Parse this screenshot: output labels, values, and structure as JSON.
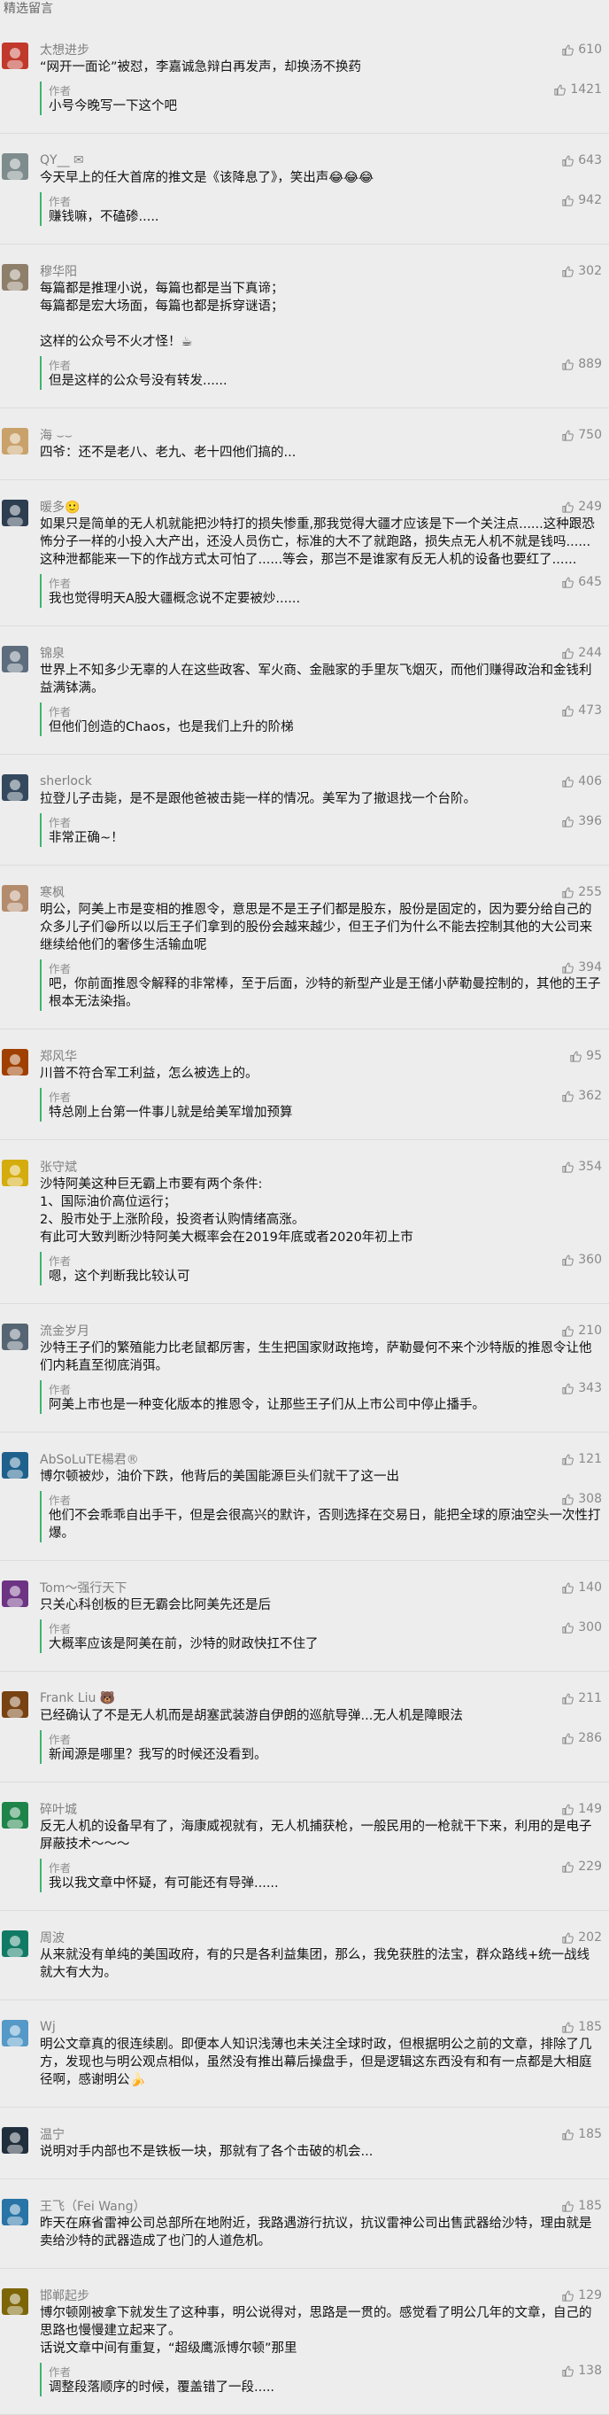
{
  "section_title": "精选留言",
  "comments": [
    {
      "nick": "太想进步",
      "likes": "610",
      "text": "“网开一面论”被怼，李嘉诚急辩白再发声，却换汤不换药",
      "reply_author": "作者",
      "reply_likes": "1421",
      "reply_text": "小号今晚写一下这个吧"
    },
    {
      "nick": "QY__ ✉",
      "likes": "643",
      "text": "今天早上的任大首席的推文是《该降息了》，笑出声😂😂😂",
      "reply_author": "作者",
      "reply_likes": "942",
      "reply_text": "赚钱嘛，不磕碜....."
    },
    {
      "nick": "穆华阳",
      "likes": "302",
      "text": "每篇都是推理小说，每篇也都是当下真谛；\n每篇都是宏大场面，每篇也都是拆穿谜语；\n\n这样的公众号不火才怪！☕",
      "reply_author": "作者",
      "reply_likes": "889",
      "reply_text": "但是这样的公众号没有转发......"
    },
    {
      "nick": "海 ⌣⌣",
      "likes": "750",
      "text": "四爷：还不是老八、老九、老十四他们搞的...",
      "reply_author": "",
      "reply_likes": "",
      "reply_text": ""
    },
    {
      "nick": "暖多🙂",
      "likes": "249",
      "text": "如果只是简单的无人机就能把沙特打的损失惨重,那我觉得大疆才应该是下一个关注点......这种跟恐怖分子一样的小投入大产出，还没人员伤亡，标准的大不了就跑路，损失点无人机不就是钱吗......这种泄都能来一下的作战方式太可怕了......等会，那岂不是谁家有反无人机的设备也要红了......",
      "reply_author": "作者",
      "reply_likes": "645",
      "reply_text": "我也觉得明天A股大疆概念说不定要被炒......"
    },
    {
      "nick": "锦泉",
      "likes": "244",
      "text": "世界上不知多少无辜的人在这些政客、军火商、金融家的手里灰飞烟灭，而他们赚得政治和金钱利益满钵满。",
      "reply_author": "作者",
      "reply_likes": "473",
      "reply_text": "但他们创造的Chaos，也是我们上升的阶梯"
    },
    {
      "nick": "sherlock",
      "likes": "406",
      "text": "拉登儿子击毙，是不是跟他爸被击毙一样的情况。美军为了撤退找一个台阶。",
      "reply_author": "作者",
      "reply_likes": "396",
      "reply_text": "非常正确~！"
    },
    {
      "nick": "寒枫",
      "likes": "255",
      "text": "明公，阿美上市是变相的推恩令，意思是不是王子们都是股东，股份是固定的，因为要分给自己的众多儿子们😁所以以后王子们拿到的股份会越来越少，但王子们为什么不能去控制其他的大公司来继续给他们的奢侈生活输血呢",
      "reply_author": "作者",
      "reply_likes": "394",
      "reply_text": "吧，你前面推恩令解释的非常棒，至于后面，沙特的新型产业是王储小萨勒曼控制的，其他的王子根本无法染指。"
    },
    {
      "nick": "郑风华",
      "likes": "95",
      "text": "川普不符合军工利益，怎么被选上的。",
      "reply_author": "作者",
      "reply_likes": "362",
      "reply_text": "特总刚上台第一件事儿就是给美军增加预算"
    },
    {
      "nick": "张守斌",
      "likes": "354",
      "text": "沙特阿美这种巨无霸上市要有两个条件:\n1、国际油价高位运行；\n2、股市处于上涨阶段，投资者认购情绪高涨。\n有此可大致判断沙特阿美大概率会在2019年底或者2020年初上市",
      "reply_author": "作者",
      "reply_likes": "360",
      "reply_text": "嗯，这个判断我比较认可"
    },
    {
      "nick": "流金岁月",
      "likes": "210",
      "text": "沙特王子们的繁殖能力比老鼠都厉害，生生把国家财政拖垮，萨勒曼何不来个沙特版的推恩令让他们内耗直至彻底消弭。",
      "reply_author": "作者",
      "reply_likes": "343",
      "reply_text": "阿美上市也是一种变化版本的推恩令，让那些王子们从上市公司中停止播手。"
    },
    {
      "nick": "AbSoLuTE楊君®",
      "likes": "121",
      "text": "博尔顿被炒，油价下跌，他背后的美国能源巨头们就干了这一出",
      "reply_author": "作者",
      "reply_likes": "308",
      "reply_text": "他们不会乖乖自出手干，但是会很高兴的默许，否则选择在交易日，能把全球的原油空头一次性打爆。"
    },
    {
      "nick": "Tom～强行天下",
      "likes": "140",
      "text": "只关心科创板的巨无霸会比阿美先还是后",
      "reply_author": "作者",
      "reply_likes": "300",
      "reply_text": "大概率应该是阿美在前，沙特的财政快扛不住了"
    },
    {
      "nick": "Frank Liu 🐻",
      "likes": "211",
      "text": "已经确认了不是无人机而是胡塞武装游自伊朗的巡航导弹...无人机是障眼法",
      "reply_author": "作者",
      "reply_likes": "286",
      "reply_text": "新闻源是哪里？我写的时候还没看到。"
    },
    {
      "nick": "碎叶城",
      "likes": "149",
      "text": "反无人机的设备早有了，海康威视就有，无人机捕获枪，一般民用的一枪就干下来，利用的是电子屏蔽技术～～～",
      "reply_author": "作者",
      "reply_likes": "229",
      "reply_text": "我以我文章中怀疑，有可能还有导弹......"
    },
    {
      "nick": "周波",
      "likes": "202",
      "text": "从来就没有单纯的美国政府，有的只是各利益集团，那么，我免获胜的法宝，群众路线+统一战线就大有大为。",
      "reply_author": "",
      "reply_likes": "",
      "reply_text": ""
    },
    {
      "nick": "Wj",
      "likes": "185",
      "text": "明公文章真的很连续剧。即便本人知识浅薄也未关注全球时政，但根据明公之前的文章，排除了几方，发现也与明公观点相似，虽然没有推出幕后操盘手，但是逻辑这东西没有和有一点都是大相庭径啊，感谢明公🍌",
      "reply_author": "",
      "reply_likes": "",
      "reply_text": ""
    },
    {
      "nick": "温宁",
      "likes": "185",
      "text": "说明对手内部也不是铁板一块，那就有了各个击破的机会...",
      "reply_author": "",
      "reply_likes": "",
      "reply_text": ""
    },
    {
      "nick": "王飞（Fei Wang）",
      "likes": "185",
      "text": "昨天在麻省雷神公司总部所在地附近，我路遇游行抗议，抗议雷神公司出售武器给沙特，理由就是卖给沙特的武器造成了也门的人道危机。",
      "reply_author": "",
      "reply_likes": "",
      "reply_text": ""
    },
    {
      "nick": "邯郸起步",
      "likes": "129",
      "text": "博尔顿刚被拿下就发生了这种事，明公说得对，思路是一贯的。感觉看了明公几年的文章，自己的思路也慢慢建立起来了。\n话说文章中间有重复，“超级鹰派博尔顿”那里",
      "reply_author": "作者",
      "reply_likes": "138",
      "reply_text": "调整段落顺序的时候，覆盖错了一段....."
    }
  ],
  "colors": {
    "background": "#ededed",
    "author_bar": "#3fb36f",
    "meta_text": "#808080"
  },
  "icons": {
    "like": "thumbs-up-icon"
  }
}
